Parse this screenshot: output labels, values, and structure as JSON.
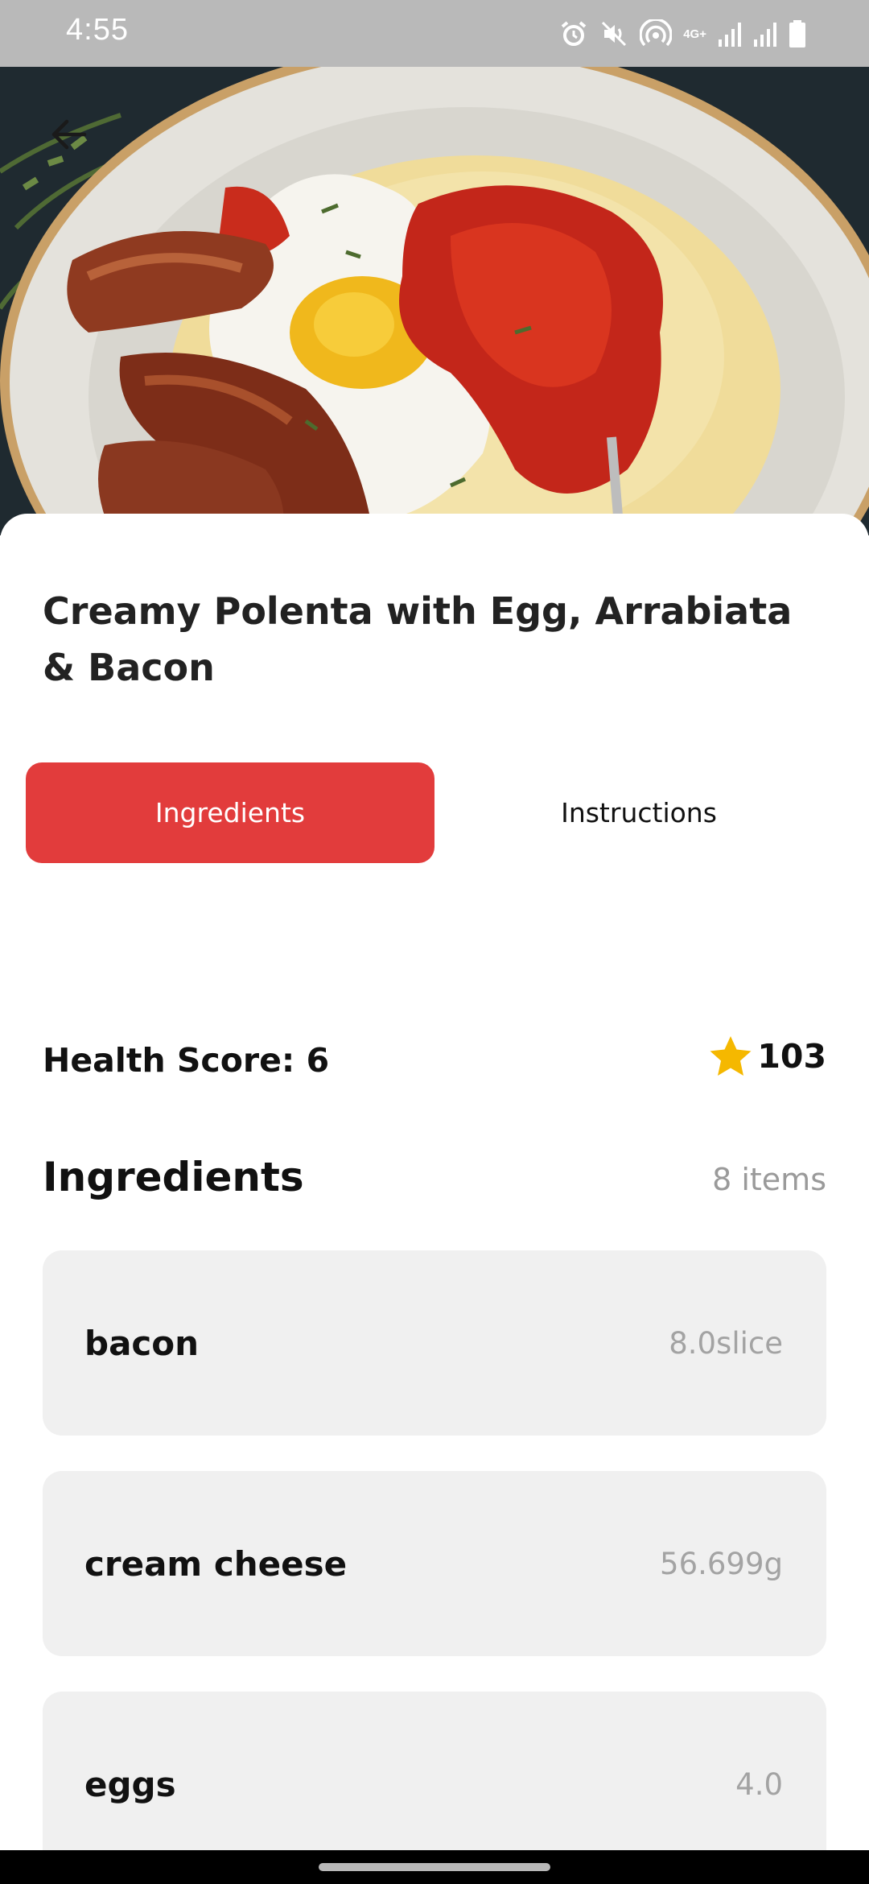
{
  "status_bar": {
    "time": "4:55",
    "network_label": "4G+"
  },
  "header": {
    "back_icon": "arrow-left-icon"
  },
  "recipe": {
    "title": "Creamy Polenta with Egg, Arrabiata & Bacon"
  },
  "tabs": [
    {
      "label": "Ingredients",
      "active": true
    },
    {
      "label": "Instructions",
      "active": false
    }
  ],
  "stats": {
    "health_score": "Health Score: 6",
    "rating_icon": "star-icon",
    "rating_value": "103"
  },
  "ingredients_section": {
    "title": "Ingredients",
    "count": "8 items",
    "items": [
      {
        "name": "bacon",
        "amount": "8.0slice"
      },
      {
        "name": "cream cheese",
        "amount": "56.699g"
      },
      {
        "name": "eggs",
        "amount": "4.0"
      }
    ]
  },
  "colors": {
    "accent": "#e23c3c",
    "star": "#f5b800",
    "card_background": "#f0f0f0",
    "muted_text": "#9a9a9a"
  }
}
